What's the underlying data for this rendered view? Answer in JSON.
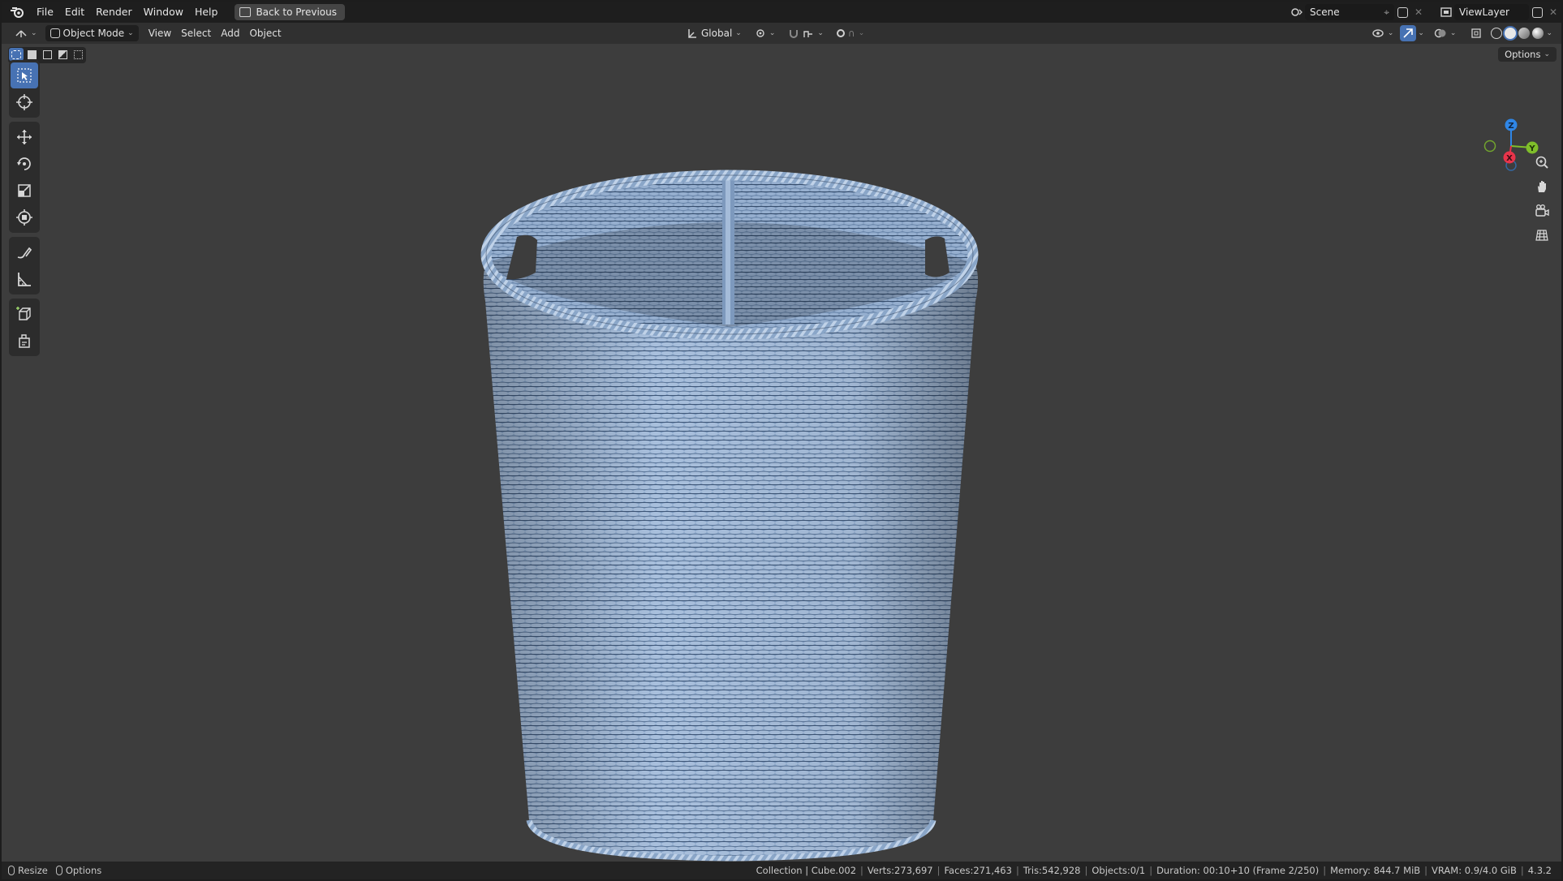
{
  "menubar": {
    "items": [
      "File",
      "Edit",
      "Render",
      "Window",
      "Help"
    ],
    "back_button": "Back to Previous",
    "scene": "Scene",
    "view_layer": "ViewLayer"
  },
  "header": {
    "mode": "Object Mode",
    "menus": [
      "View",
      "Select",
      "Add",
      "Object"
    ],
    "transform_orientation": "Global",
    "options_label": "Options"
  },
  "toolbar": {
    "tools": [
      {
        "icon": "select-box-icon",
        "active": true
      },
      {
        "icon": "cursor-icon",
        "active": false
      },
      {
        "icon": "move-icon",
        "active": false
      },
      {
        "icon": "rotate-icon",
        "active": false
      },
      {
        "icon": "scale-icon",
        "active": false
      },
      {
        "icon": "transform-icon",
        "active": false
      },
      {
        "icon": "annotate-icon",
        "active": false
      },
      {
        "icon": "measure-icon",
        "active": false
      },
      {
        "icon": "add-cube-icon",
        "active": false
      },
      {
        "icon": "add-object-icon",
        "active": false
      }
    ]
  },
  "gizmo": {
    "x": "X",
    "y": "Y",
    "z": "Z",
    "colors": {
      "x": "#e8344a",
      "y": "#7fbe2a",
      "z": "#2f86e6"
    }
  },
  "statusbar": {
    "left": {
      "resize": "Resize",
      "options": "Options"
    },
    "stats": [
      "Collection | Cube.002",
      "Verts:273,697",
      "Faces:271,463",
      "Tris:542,928",
      "Objects:0/1",
      "Duration: 00:10+10 (Frame 2/250)",
      "Memory: 844.7 MiB",
      "VRAM: 0.9/4.0 GiB",
      "4.3.2"
    ]
  },
  "colors": {
    "accent": "#4772b3",
    "viewport_bg": "#3d3d3d",
    "model": "#8aa6c8"
  }
}
